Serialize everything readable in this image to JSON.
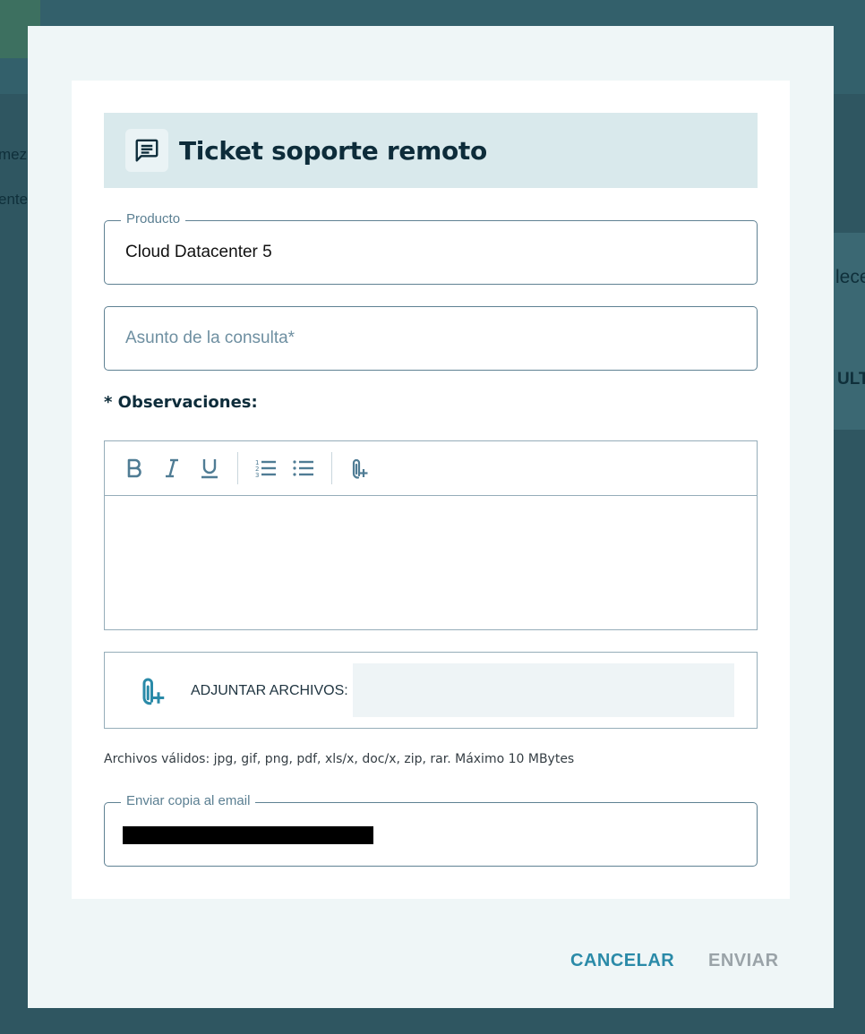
{
  "background": {
    "snippets": [
      "mez.",
      "ente",
      "lece",
      "ULT"
    ]
  },
  "modal": {
    "title": "Ticket soporte remoto",
    "title_icon": "chat-message-icon",
    "producto": {
      "label": "Producto",
      "value": "Cloud Datacenter 5"
    },
    "asunto": {
      "placeholder": "Asunto de la consulta*"
    },
    "observaciones": {
      "label": "* Observaciones:",
      "toolbar": [
        "bold-icon",
        "italic-icon",
        "underline-icon",
        "ordered-list-icon",
        "bullet-list-icon",
        "attach-icon"
      ]
    },
    "adjuntar": {
      "label": "ADJUNTAR ARCHIVOS:",
      "icon": "attach-icon"
    },
    "valid_files": "Archivos válidos: jpg, gif, png, pdf, xls/x, doc/x, zip, rar. Máximo 10 MBytes",
    "email_copy": {
      "label": "Enviar copia al email",
      "value_redacted": true
    },
    "buttons": {
      "cancel": "CANCELAR",
      "send": "ENVIAR"
    },
    "colors": {
      "accent": "#2a8aa8",
      "disabled": "#9aa3a8",
      "header_bg": "#d9e9ec"
    }
  }
}
